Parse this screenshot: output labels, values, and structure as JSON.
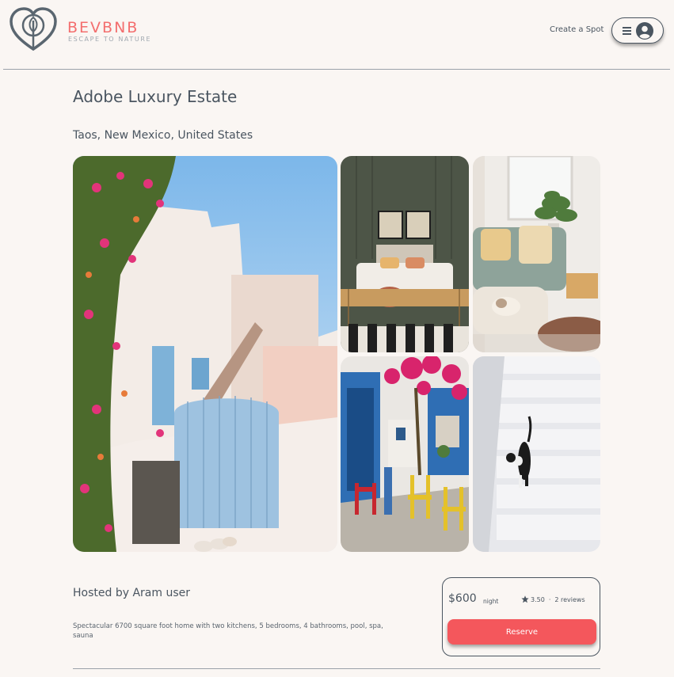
{
  "brand": {
    "name": "BEVBNB",
    "tagline": "ESCAPE TO NATURE",
    "accent_color": "#f36e6e",
    "logo_icon": "heart-leaf-logo"
  },
  "nav": {
    "create_spot": "Create a Spot",
    "menu_icon": "hamburger-icon",
    "user_icon": "user-avatar-icon"
  },
  "spot": {
    "title": "Adobe Luxury Estate",
    "location": "Taos, New Mexico, United States",
    "host": "Hosted by Aram user",
    "description": "Spectacular 6700 square foot home with two kitchens, 5 bedrooms, 4 bathrooms, pool, spa, sauna"
  },
  "gallery": {
    "images": [
      {
        "subject": "whitewashed-house-with-blue-gate"
      },
      {
        "subject": "bedroom-with-wicker-bench"
      },
      {
        "subject": "living-room-with-dog"
      },
      {
        "subject": "blue-door-street-with-colorful-chairs"
      },
      {
        "subject": "cat-on-white-stairs"
      }
    ]
  },
  "booking": {
    "price": "$600",
    "price_unit": "night",
    "rating": "3.50",
    "reviews": "2 reviews",
    "reserve_label": "Reserve",
    "reserve_color": "#f4575c"
  }
}
